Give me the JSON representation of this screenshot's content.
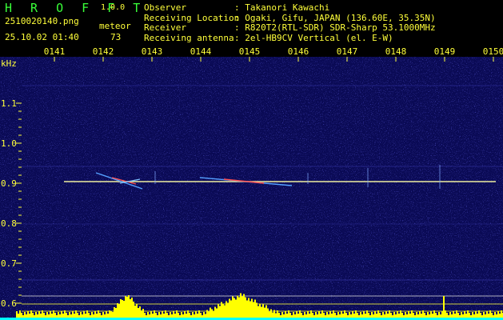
{
  "app": {
    "logo": "H R O F F T",
    "version": "1.0.0"
  },
  "capture": {
    "filename": "2510020140.png",
    "timestamp": "25.10.02 01:40",
    "event_type": "meteor",
    "event_count": "73"
  },
  "station": [
    {
      "label": "Observer",
      "value": ": Takanori Kawachi"
    },
    {
      "label": "Receiving Location",
      "value": ": Ogaki, Gifu, JAPAN (136.60E, 35.35N)"
    },
    {
      "label": "Receiver",
      "value": ": R820T2(RTL-SDR) SDR-Sharp 53.1000MHz"
    },
    {
      "label": "Receiving antenna",
      "value": ": 2el-HB9CV Vertical (el. E-W)"
    }
  ],
  "axes": {
    "freq_unit": "kHz",
    "freq_ticks": [
      "1.1",
      "1.0",
      "0.9",
      "0.8",
      "0.7",
      "0.6"
    ],
    "time_ticks": [
      "0141",
      "0142",
      "0143",
      "0144",
      "0145",
      "0146",
      "0147",
      "0148",
      "0149",
      "0150"
    ]
  },
  "colors": {
    "background": "#000000",
    "waterfall": "#0a0a55",
    "tick": "#ffff3a",
    "carrier": "#f0f0a0",
    "spectrum_fill": "#ffff00",
    "spectrum_base": "#00ffff",
    "logo": "#39ff39"
  }
}
